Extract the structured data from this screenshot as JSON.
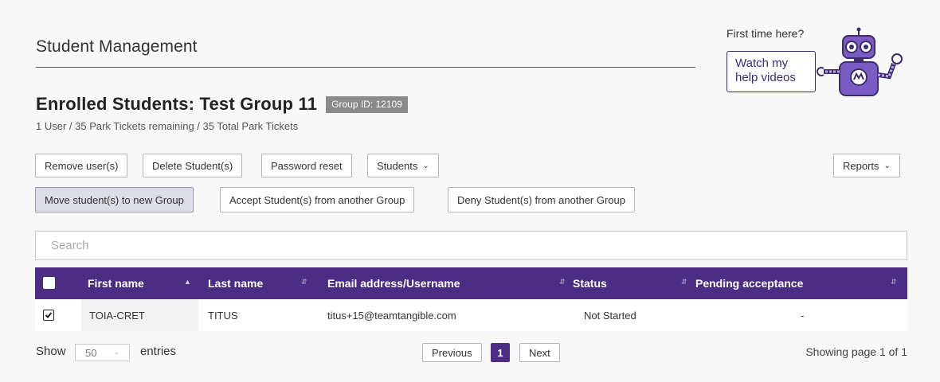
{
  "page": {
    "title": "Student Management"
  },
  "helper": {
    "question": "First time here?",
    "line1": "Watch my",
    "line2": "help videos"
  },
  "heading": {
    "title": "Enrolled Students: Test Group 11",
    "badge": "Group ID: 12109",
    "summary": "1 User / 35 Park Tickets remaining / 35 Total Park Tickets"
  },
  "toolbar": {
    "remove_users": "Remove user(s)",
    "delete_students": "Delete Student(s)",
    "password_reset": "Password reset",
    "students_menu": "Students",
    "reports_menu": "Reports",
    "move_students": "Move student(s) to new Group",
    "accept_students": "Accept Student(s) from another Group",
    "deny_students": "Deny Student(s) from another Group"
  },
  "search": {
    "placeholder": "Search",
    "value": ""
  },
  "table": {
    "columns": [
      {
        "label": "First name",
        "sort": "asc"
      },
      {
        "label": "Last name",
        "sort": "both"
      },
      {
        "label": "Email address/Username",
        "sort": "both"
      },
      {
        "label": "Status",
        "sort": "both"
      },
      {
        "label": "Pending acceptance",
        "sort": "both"
      }
    ],
    "rows": [
      {
        "checked": true,
        "first_name": "TOIA-CRET",
        "last_name": "TITUS",
        "email": "titus+15@teamtangible.com",
        "status": "Not Started",
        "pending": "-"
      }
    ]
  },
  "footer": {
    "show": "Show",
    "page_length": "50",
    "entries": "entries",
    "previous": "Previous",
    "current_page": "1",
    "next": "Next",
    "showing": "Showing page 1 of 1"
  },
  "colors": {
    "accent": "#4b2d84",
    "robot": "#7b5cc4"
  },
  "icons": {
    "sort_asc": "sort-ascending-icon",
    "sort_both": "sort-both-icon",
    "chevron": "chevron-down-icon",
    "checkbox": "checkbox-icon",
    "robot": "robot-mascot-icon"
  }
}
